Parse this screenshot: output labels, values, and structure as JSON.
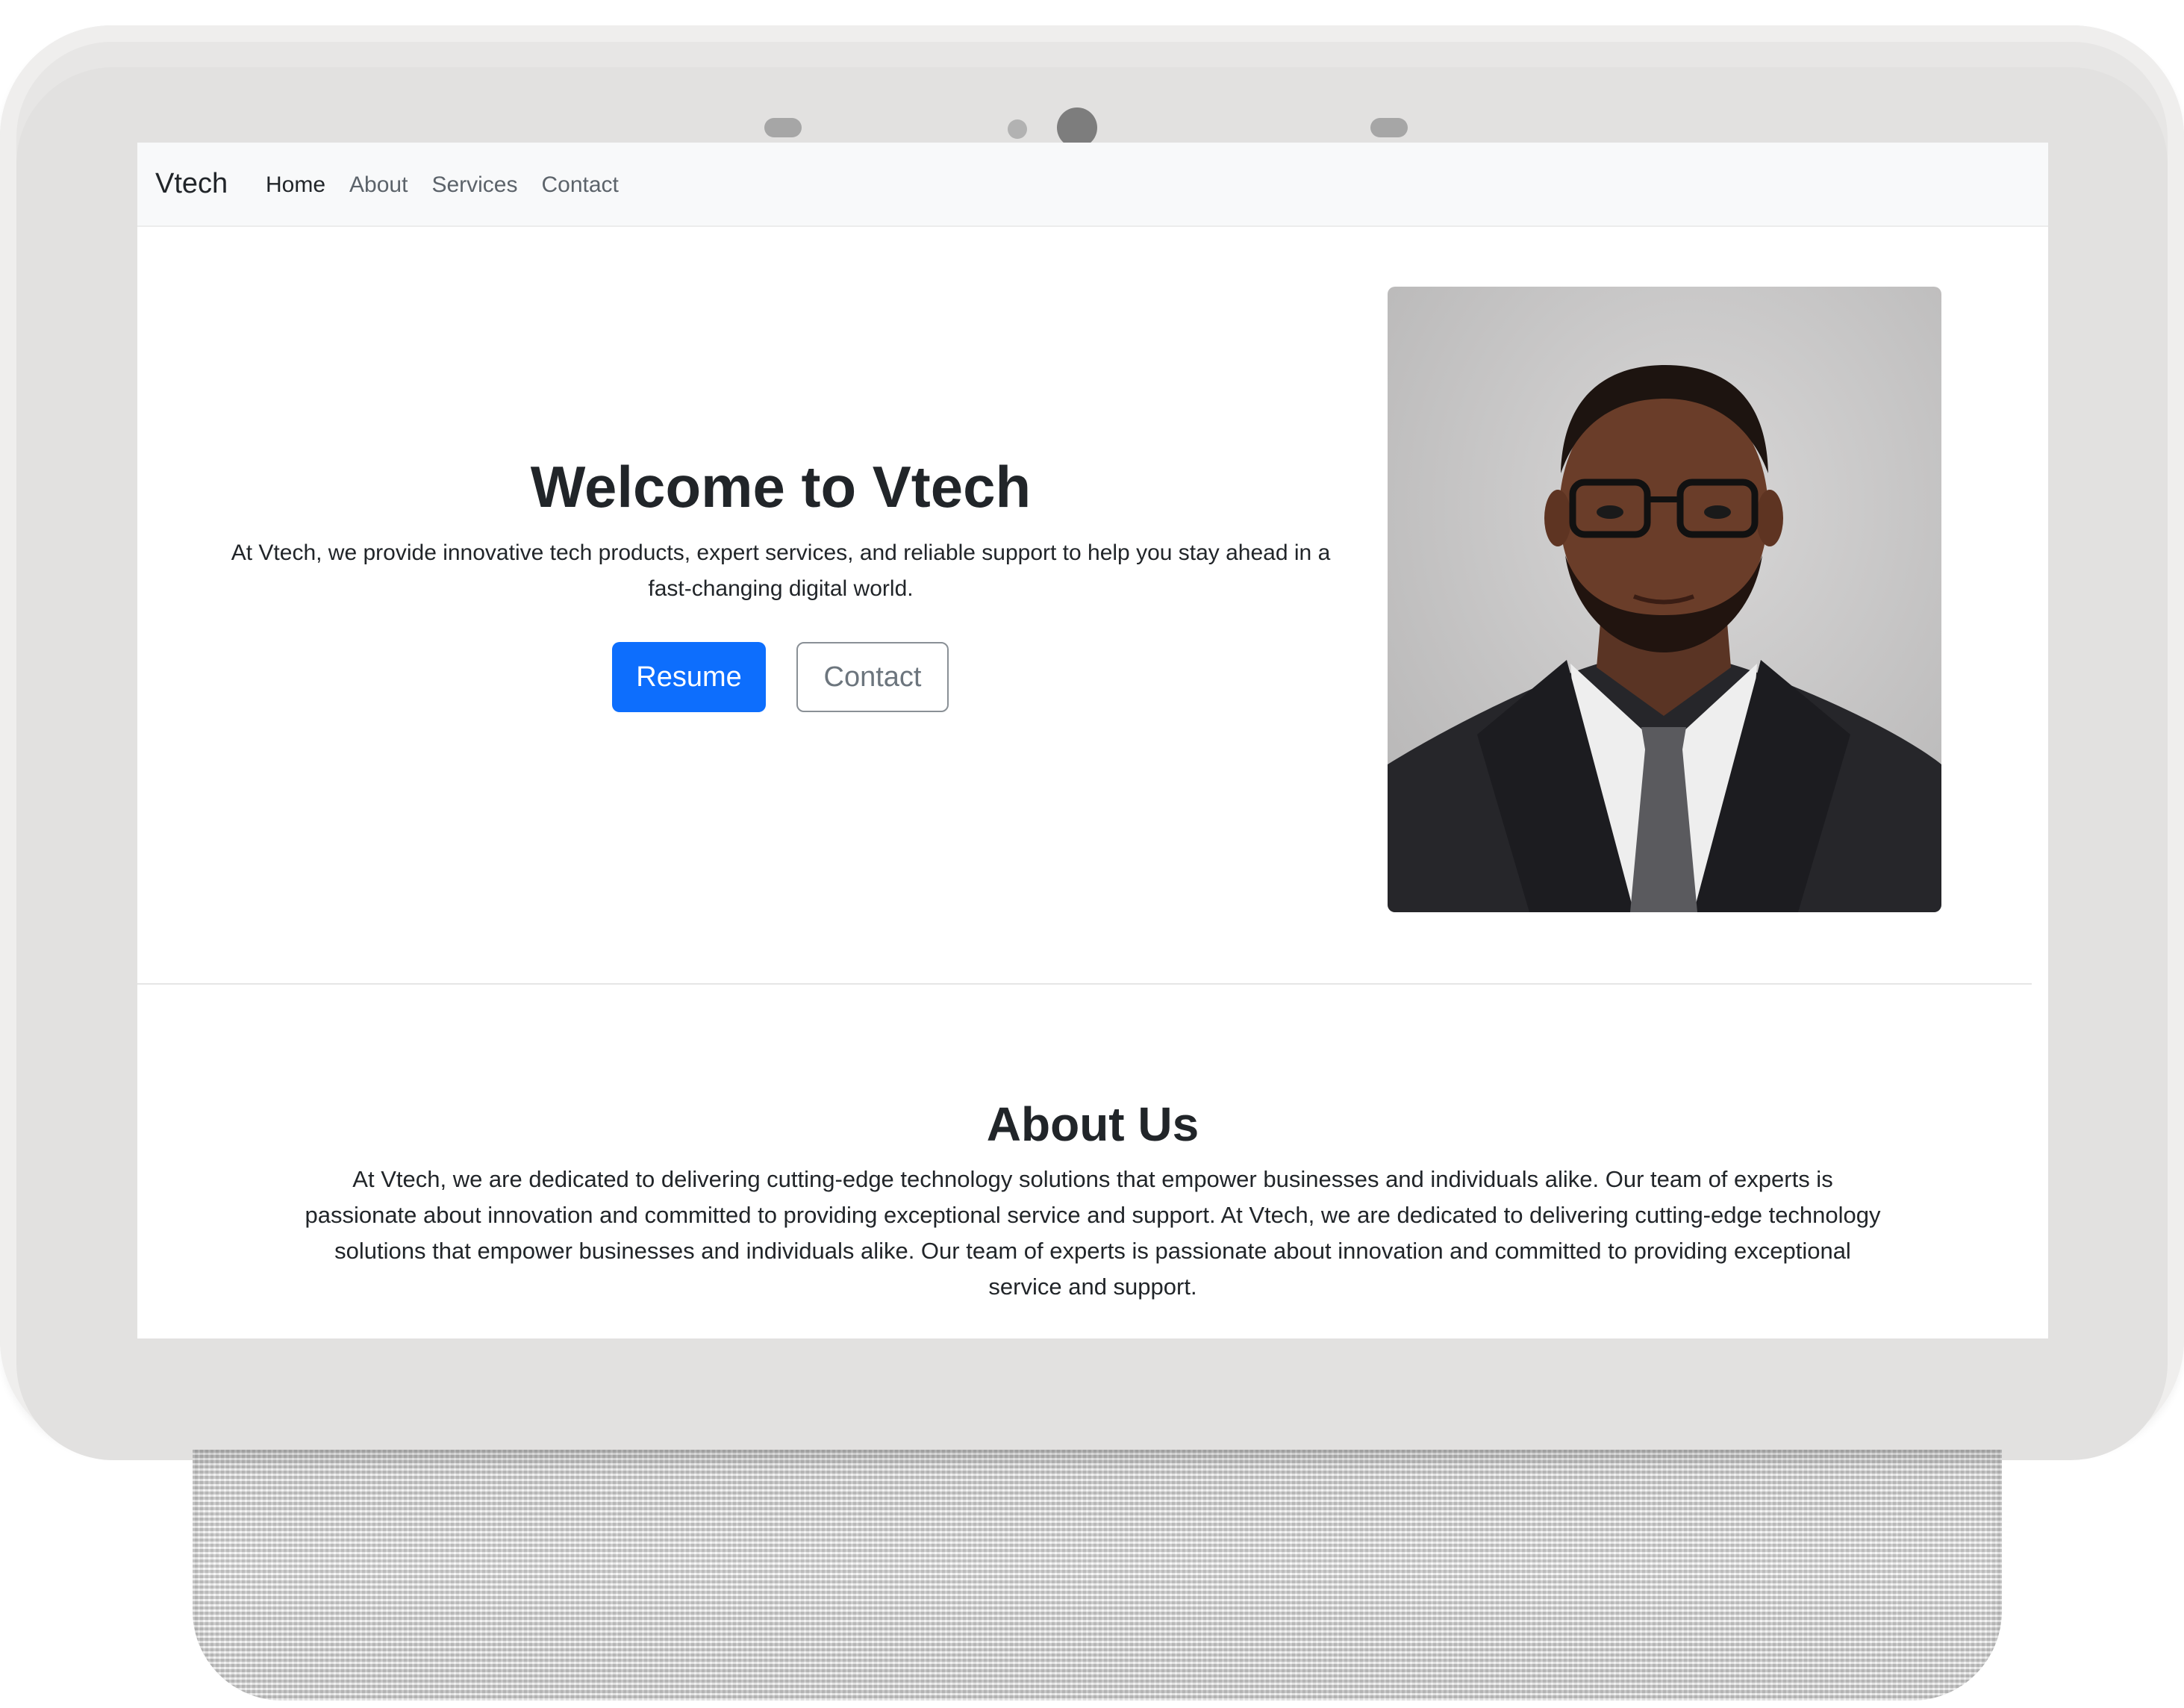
{
  "navbar": {
    "brand": "Vtech",
    "links": [
      "Home",
      "About",
      "Services",
      "Contact"
    ],
    "active": "Home"
  },
  "hero": {
    "title": "Welcome to Vtech",
    "text": "At Vtech, we provide innovative tech products, expert services, and reliable support to help you stay ahead in a fast-changing digital world.",
    "resume_button": "Resume",
    "contact_button": "Contact",
    "photo_alt": "portrait-photo"
  },
  "about": {
    "title": "About Us",
    "text": "At Vtech, we are dedicated to delivering cutting-edge technology solutions that empower businesses and individuals alike. Our team of experts is passionate about innovation and committed to providing exceptional service and support. At Vtech, we are dedicated to delivering cutting-edge technology solutions that empower businesses and individuals alike. Our team of experts is passionate about innovation and committed to providing exceptional service and support."
  },
  "colors": {
    "primary": "#0d6efd",
    "navbar_bg": "#f8f9fa",
    "text": "#212529",
    "muted": "#6c757d"
  }
}
